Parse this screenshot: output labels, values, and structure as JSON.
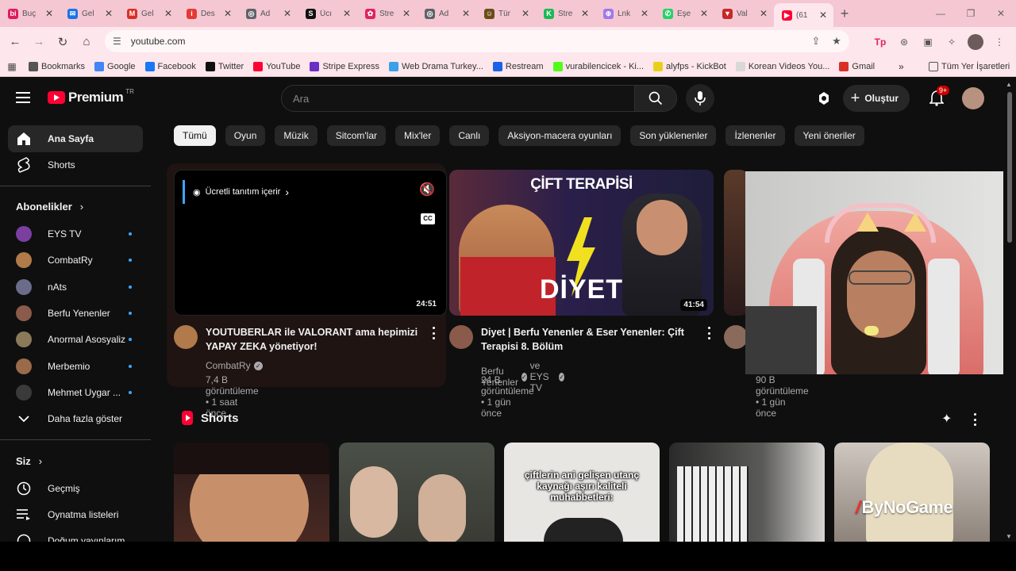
{
  "browser": {
    "tabs": [
      {
        "label": "Buç",
        "color": "#e01b5e",
        "glyph": "bi"
      },
      {
        "label": "Gel",
        "color": "#1a73e8",
        "glyph": "✉"
      },
      {
        "label": "Gel",
        "color": "#d93025",
        "glyph": "M"
      },
      {
        "label": "Des",
        "color": "#e53935",
        "glyph": "i"
      },
      {
        "label": "Ad",
        "color": "#5f6368",
        "glyph": "◎"
      },
      {
        "label": "Ücı",
        "color": "#111111",
        "glyph": "S"
      },
      {
        "label": "Stre",
        "color": "#e0245e",
        "glyph": "✿"
      },
      {
        "label": "Ad",
        "color": "#5f6368",
        "glyph": "◎"
      },
      {
        "label": "Tür",
        "color": "#6b4e16",
        "glyph": "☺"
      },
      {
        "label": "Stre",
        "color": "#1db954",
        "glyph": "K"
      },
      {
        "label": "Lnk",
        "color": "#a078e8",
        "glyph": "⊕"
      },
      {
        "label": "Eşe",
        "color": "#25d366",
        "glyph": "✆"
      },
      {
        "label": "Val",
        "color": "#c62828",
        "glyph": "▼"
      },
      {
        "label": "(61",
        "color": "#ff0033",
        "glyph": "▶",
        "active": true
      }
    ],
    "url": "youtube.com",
    "bookmarks": [
      {
        "label": "Bookmarks",
        "color": "#555555"
      },
      {
        "label": "Google",
        "color": "#4285f4"
      },
      {
        "label": "Facebook",
        "color": "#1877f2"
      },
      {
        "label": "Twitter",
        "color": "#111111"
      },
      {
        "label": "YouTube",
        "color": "#ff0033"
      },
      {
        "label": "Stripe Express",
        "color": "#6a30c4"
      },
      {
        "label": "Web Drama Turkey...",
        "color": "#3aa0e8"
      },
      {
        "label": "Restream",
        "color": "#1a62e8"
      },
      {
        "label": "vurabilencicek - Ki...",
        "color": "#53fc18"
      },
      {
        "label": "alyfps - KickBot",
        "color": "#e8d01a"
      },
      {
        "label": "Korean Videos You...",
        "color": "#d8d8d8"
      },
      {
        "label": "Gmail",
        "color": "#d93025"
      }
    ],
    "all_bookmarks": "Tüm Yer İşaretleri"
  },
  "youtube": {
    "logo_word": "Premium",
    "logo_region": "TR",
    "search_placeholder": "Ara",
    "create_label": "Oluştur",
    "notif_count": "9+",
    "sidebar": {
      "home": "Ana Sayfa",
      "shorts": "Shorts",
      "subs_header": "Abonelikler",
      "channels": [
        {
          "name": "EYS TV",
          "color": "#7b3fa0"
        },
        {
          "name": "CombatRy",
          "color": "#b07a4a"
        },
        {
          "name": "nAts",
          "color": "#6b6b8a"
        },
        {
          "name": "Berfu Yenenler",
          "color": "#8a5a4a"
        },
        {
          "name": "Anormal Asosyaliz",
          "color": "#8a7a5a"
        },
        {
          "name": "Merbemio",
          "color": "#9a6a4a"
        },
        {
          "name": "Mehmet Uygar ...",
          "color": "#3a3a3a"
        }
      ],
      "show_more": "Daha fazla göster",
      "you_header": "Siz",
      "history": "Geçmiş",
      "playlists": "Oynatma listeleri",
      "partial": "Doğum yayınlarım"
    },
    "chips": [
      "Tümü",
      "Oyun",
      "Müzik",
      "Sitcom'lar",
      "Mix'ler",
      "Canlı",
      "Aksiyon-macera oyunları",
      "Son yüklenenler",
      "İzlenenler",
      "Yeni öneriler"
    ],
    "videos": [
      {
        "promo": "Ücretli tanıtım içerir",
        "duration": "24:51",
        "title": "YOUTUBERLAR ile VALORANT ama hepimizi YAPAY ZEKA yönetiyor!",
        "channel": "CombatRy",
        "stats": "7,4 B görüntüleme • 1 saat önce"
      },
      {
        "thumb_title": "ÇİFT TERAPİSİ",
        "thumb_word": "DİYET",
        "duration": "41:54",
        "title": "Diyet | Berfu Yenenler & Eser Yenenler: Çift Terapisi 8. Bölüm",
        "channel": "Berfu Yenenler",
        "channel2": "ve EYS TV",
        "stats": "24 B görüntüleme • 1 gün önce"
      },
      {
        "stats": "90 B görüntüleme • 1 gün önce"
      }
    ],
    "shorts_header": "Shorts",
    "short_caption": "çiftlerin ani gelişen utanç kaynağı aşırı kaliteli muhabbetleri:",
    "watermark": "ByNoGame"
  }
}
